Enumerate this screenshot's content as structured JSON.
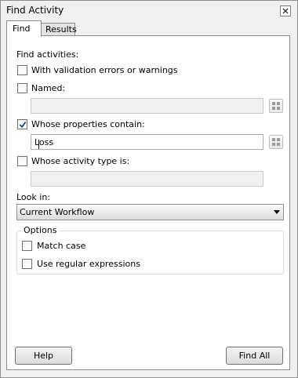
{
  "window": {
    "title": "Find Activity"
  },
  "tabs": [
    {
      "label": "Find"
    },
    {
      "label": "Results"
    }
  ],
  "find": {
    "heading": "Find activities:",
    "validation": {
      "label": "With validation errors or warnings",
      "checked": false
    },
    "named": {
      "label": "Named:",
      "checked": false,
      "value": ""
    },
    "properties": {
      "label": "Whose properties contain:",
      "checked": true,
      "value": "Loss"
    },
    "activity_type": {
      "label": "Whose activity type is:",
      "checked": false,
      "value": ""
    },
    "look_in": {
      "label": "Look in:",
      "selected": "Current Workflow"
    },
    "options": {
      "title": "Options",
      "match_case": {
        "label": "Match case",
        "checked": false
      },
      "regex": {
        "label": "Use regular expressions",
        "checked": false
      }
    }
  },
  "buttons": {
    "help": "Help",
    "find_all": "Find All"
  }
}
